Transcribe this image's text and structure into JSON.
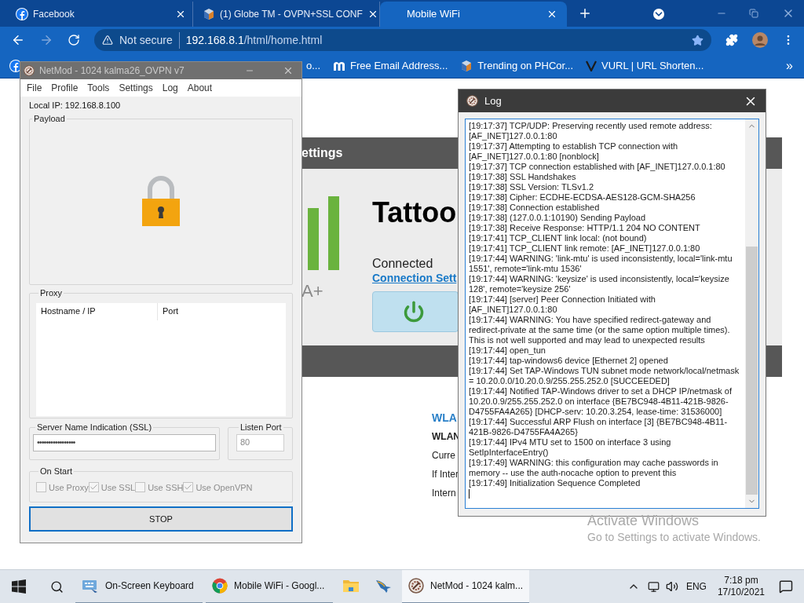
{
  "browser": {
    "tabs": [
      {
        "title": "Facebook",
        "selected": false
      },
      {
        "title": "(1) Globe TM - OVPN+SSL CONF",
        "selected": false
      },
      {
        "title": "Mobile WiFi",
        "selected": true
      }
    ],
    "address": {
      "security": "Not secure",
      "host": "192.168.8.1",
      "path": "/html/home.html"
    },
    "bookmarks": [
      {
        "label": "o..."
      },
      {
        "label": "Free Email Address..."
      },
      {
        "label": "Trending on PHCor..."
      },
      {
        "label": "VURL | URL Shorten..."
      }
    ],
    "bookmarks_overflow": "»"
  },
  "router_page": {
    "band_title": "ettings",
    "device_name": "Tattoo",
    "status": "Connected",
    "settings_link": "Connection Sett",
    "rating": "A+",
    "wlan_heading": "WLA",
    "lines": [
      "WLAN",
      "Curre",
      "If Inter",
      "Intern"
    ]
  },
  "netmod": {
    "title": "NetMod - 1024 kalma26_OVPN v7",
    "menu": [
      "File",
      "Profile",
      "Tools",
      "Settings",
      "Log",
      "About"
    ],
    "local_ip": "Local IP: 192.168.8.100",
    "payload_label": "Payload",
    "proxy_label": "Proxy",
    "proxy_columns": [
      "Hostname / IP",
      "Port"
    ],
    "sni_label": "Server Name Indication (SSL)",
    "sni_value": "•••••••••••••••••",
    "port_label": "Listen Port",
    "port_value": "80",
    "on_start_label": "On Start",
    "options": [
      {
        "label": "Use Proxy",
        "checked": false
      },
      {
        "label": "Use SSL",
        "checked": true
      },
      {
        "label": "Use SSH",
        "checked": false
      },
      {
        "label": "Use OpenVPN",
        "checked": true
      }
    ],
    "button": "STOP"
  },
  "log_window": {
    "title": "Log",
    "lines": [
      "[19:17:37] TCP/UDP: Preserving recently used remote address: [AF_INET]127.0.0.1:80",
      "[19:17:37] Attempting to establish TCP connection with [AF_INET]127.0.0.1:80 [nonblock]",
      "[19:17:37] TCP connection established with [AF_INET]127.0.0.1:80",
      "[19:17:38] SSL Handshakes",
      "[19:17:38] SSL Version: TLSv1.2",
      "[19:17:38] Cipher: ECDHE-ECDSA-AES128-GCM-SHA256",
      "[19:17:38] Connection established",
      "[19:17:38] (127.0.0.1:10190) Sending Payload",
      "[19:17:38] Receive Response: HTTP/1.1 204 NO CONTENT",
      "[19:17:41] TCP_CLIENT link local: (not bound)",
      "[19:17:41] TCP_CLIENT link remote: [AF_INET]127.0.0.1:80",
      "[19:17:44] WARNING: 'link-mtu' is used inconsistently, local='link-mtu 1551', remote='link-mtu 1536'",
      "[19:17:44] WARNING: 'keysize' is used inconsistently, local='keysize 128', remote='keysize 256'",
      "[19:17:44] [server] Peer Connection Initiated with [AF_INET]127.0.0.1:80",
      "[19:17:44] WARNING: You have specified redirect-gateway and redirect-private at the same time (or the same option multiple times). This is not well supported and may lead to unexpected results",
      "[19:17:44] open_tun",
      "[19:17:44] tap-windows6 device [Ethernet 2] opened",
      "[19:17:44] Set TAP-Windows TUN subnet mode network/local/netmask = 10.20.0.0/10.20.0.9/255.255.252.0 [SUCCEEDED]",
      "[19:17:44] Notified TAP-Windows driver to set a DHCP IP/netmask of 10.20.0.9/255.255.252.0 on interface {BE7BC948-4B11-421B-9826-D4755FA4A265} [DHCP-serv: 10.20.3.254, lease-time: 31536000]",
      "[19:17:44] Successful ARP Flush on interface [3] {BE7BC948-4B11-421B-9826-D4755FA4A265}",
      "[19:17:44] IPv4 MTU set to 1500 on interface 3 using SetIpInterfaceEntry()",
      "[19:17:49] WARNING: this configuration may cache passwords in memory -- use the auth-nocache option to prevent this",
      "[19:17:49] Initialization Sequence Completed"
    ]
  },
  "activation": {
    "title": "Activate Windows",
    "hint": "Go to Settings to activate Windows."
  },
  "taskbar": {
    "apps": [
      {
        "kind": "keyboard",
        "label": "On-Screen Keyboard",
        "running": true,
        "selected": false
      },
      {
        "kind": "chrome",
        "label": "Mobile WiFi - Googl...",
        "running": true,
        "selected": false
      },
      {
        "kind": "folder",
        "running": false,
        "selected": false
      },
      {
        "kind": "bird",
        "running": false,
        "selected": false
      },
      {
        "kind": "netmod",
        "label": "NetMod - 1024 kalm...",
        "running": true,
        "selected": true
      }
    ],
    "language": "ENG",
    "time": "7:18 pm",
    "date": "17/10/2021"
  }
}
